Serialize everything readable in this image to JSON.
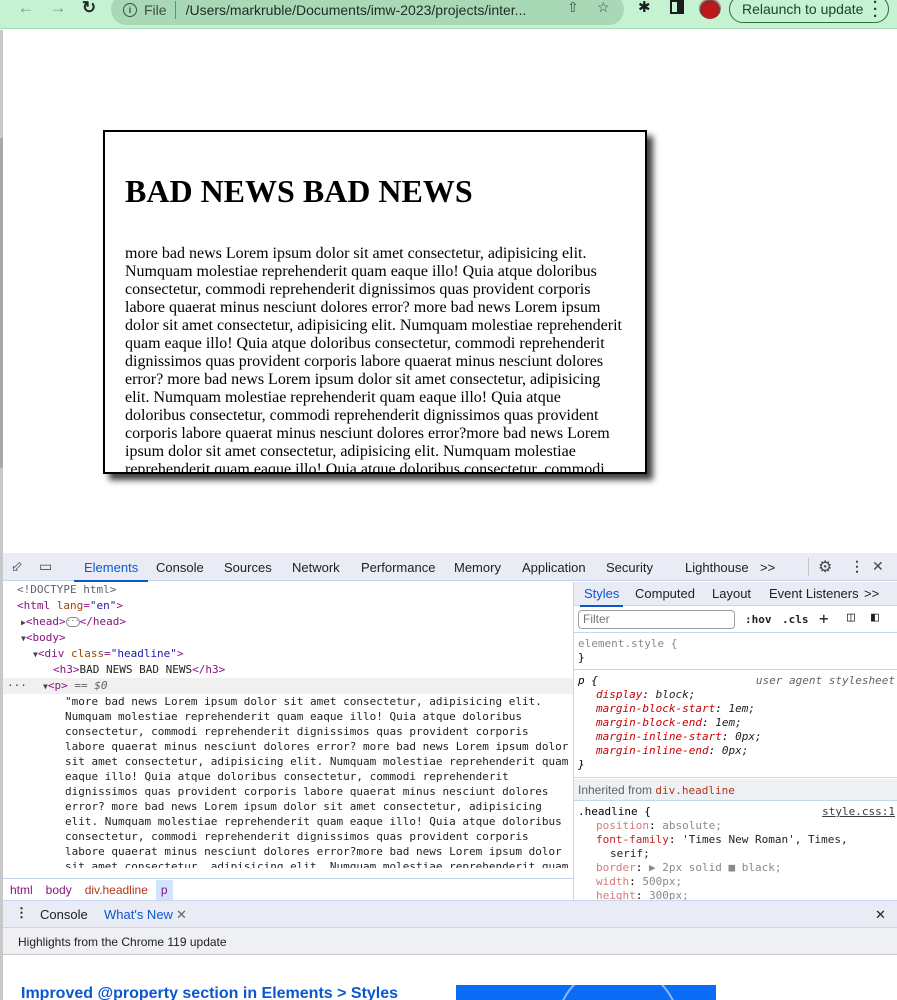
{
  "browser": {
    "url_scheme_label": "File",
    "url": "/Users/markruble/Documents/imw-2023/projects/inter...",
    "relaunch_label": "Relaunch to update",
    "icons": [
      "back-arrow-icon",
      "forward-arrow-icon",
      "reload-icon",
      "info-icon",
      "share-icon",
      "bookmark-star-icon",
      "extensions-puzzle-icon",
      "side-panel-icon",
      "profile-avatar",
      "more-menu-icon"
    ]
  },
  "page": {
    "headline": "BAD NEWS BAD NEWS",
    "paragraph": "more bad news Lorem ipsum dolor sit amet consectetur, adipisicing elit. Numquam molestiae reprehenderit quam eaque illo! Quia atque doloribus consectetur, commodi reprehenderit dignissimos quas provident corporis labore quaerat minus nesciunt dolores error? more bad news Lorem ipsum dolor sit amet consectetur, adipisicing elit. Numquam molestiae reprehenderit quam eaque illo! Quia atque doloribus consectetur, commodi reprehenderit dignissimos quas provident corporis labore quaerat minus nesciunt dolores error? more bad news Lorem ipsum dolor sit amet consectetur, adipisicing elit. Numquam molestiae reprehenderit quam eaque illo! Quia atque doloribus consectetur, commodi reprehenderit dignissimos quas provident corporis labore quaerat minus nesciunt dolores error?more bad news Lorem ipsum dolor sit amet consectetur, adipisicing elit. Numquam molestiae reprehenderit quam eaque illo! Quia atque doloribus consectetur, commodi"
  },
  "devtools": {
    "tabs": [
      "Elements",
      "Console",
      "Sources",
      "Network",
      "Performance",
      "Memory",
      "Application",
      "Security",
      "Lighthouse"
    ],
    "active_tab": "Elements",
    "more_tabs": ">>",
    "dom": {
      "doctype": "<!DOCTYPE html>",
      "html_tag": "html",
      "html_attr": "lang",
      "html_attr_val": "\"en\"",
      "head_open": "<head>",
      "head_close": "</head>",
      "body_open": "<body>",
      "div_tag": "div",
      "div_attr": "class",
      "div_attr_val": "\"headline\"",
      "h3_open": "<h3>",
      "h3_text": "BAD NEWS BAD NEWS",
      "h3_close": "</h3>",
      "p_open": "<p>",
      "p_marker": "== $0",
      "p_text": "\"more bad news Lorem ipsum dolor sit amet consectetur, adipisicing elit. Numquam molestiae reprehenderit quam eaque illo! Quia atque doloribus consectetur, commodi reprehenderit dignissimos quas provident corporis labore quaerat minus nesciunt dolores error? more bad news Lorem ipsum dolor sit amet consectetur, adipisicing elit. Numquam molestiae reprehenderit quam eaque illo! Quia atque doloribus consectetur, commodi reprehenderit dignissimos quas provident corporis labore quaerat minus nesciunt dolores error? more bad news Lorem ipsum dolor sit amet consectetur, adipisicing elit. Numquam molestiae reprehenderit quam eaque illo! Quia atque doloribus consectetur, commodi reprehenderit dignissimos quas provident corporis labore quaerat minus nesciunt dolores error?more bad news Lorem ipsum dolor sit amet consectetur, adipisicing elit. Numquam molestiae reprehenderit quam"
    },
    "breadcrumbs": [
      "html",
      "body",
      "div.headline",
      "p"
    ],
    "styles": {
      "tabs": [
        "Styles",
        "Computed",
        "Layout",
        "Event Listeners"
      ],
      "more": ">>",
      "filter_placeholder": "Filter",
      "hov": ":hov",
      "cls": ".cls",
      "element_style": "element.style {",
      "close_brace": "}",
      "p_rule": {
        "selector": "p {",
        "source": "user agent stylesheet",
        "props": [
          {
            "name": "display",
            "value": "block;"
          },
          {
            "name": "margin-block-start",
            "value": "1em;"
          },
          {
            "name": "margin-block-end",
            "value": "1em;"
          },
          {
            "name": "margin-inline-start",
            "value": "0px;"
          },
          {
            "name": "margin-inline-end",
            "value": "0px;"
          }
        ]
      },
      "inherited_label": "Inherited from",
      "inherited_selector": "div.headline",
      "headline_rule": {
        "selector": ".headline {",
        "source": "style.css:1",
        "props": [
          {
            "name": "position",
            "value": "absolute;"
          },
          {
            "name": "font-family",
            "value": "'Times New Roman', Times,"
          },
          {
            "name": "",
            "value": "serif;"
          },
          {
            "name": "border",
            "value": "▶ 2px solid ■ black;"
          },
          {
            "name": "width",
            "value": "500px;"
          },
          {
            "name": "height",
            "value": "300px;"
          }
        ]
      }
    },
    "drawer": {
      "tabs": [
        "Console",
        "What's New"
      ],
      "active_tab": "What's New",
      "highlights": "Highlights from the Chrome 119 update",
      "heading": "Improved @property section in Elements > Styles"
    }
  }
}
